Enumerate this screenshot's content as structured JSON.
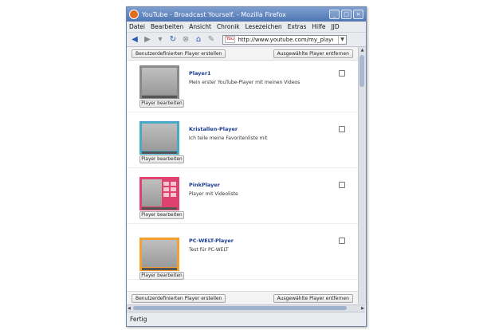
{
  "window": {
    "title": "YouTube - Broadcast Yourself. - Mozilla Firefox",
    "controls": [
      "_",
      "□",
      "×"
    ]
  },
  "menu": {
    "items": [
      "Datei",
      "Bearbeiten",
      "Ansicht",
      "Chronik",
      "Lesezeichen",
      "Extras",
      "Hilfe",
      "JJD"
    ]
  },
  "nav": {
    "url": "http://www.youtube.com/my_players"
  },
  "toolbar": {
    "create_label": "Benutzerdefinierten Player erstellen",
    "remove_label": "Ausgewählte Player entfernen"
  },
  "players": [
    {
      "name": "Player1",
      "description": "Mein erster YouTube-Player mit meinen Videos",
      "edit_label": "Player bearbeiten",
      "color": "#8a8a8a"
    },
    {
      "name": "Kristallen-Player",
      "description": "Ich teile meine Favoritenliste mit",
      "edit_label": "Player bearbeiten",
      "color": "#4aa8c9"
    },
    {
      "name": "PinkPlayer",
      "description": "Player mit Videoliste",
      "edit_label": "Player bearbeiten",
      "color": "#e0426f"
    },
    {
      "name": "PC-WELT-Player",
      "description": "Test für PC-WELT",
      "edit_label": "Player bearbeiten",
      "color": "#f2a030"
    }
  ],
  "status": {
    "text": "Fertig"
  }
}
